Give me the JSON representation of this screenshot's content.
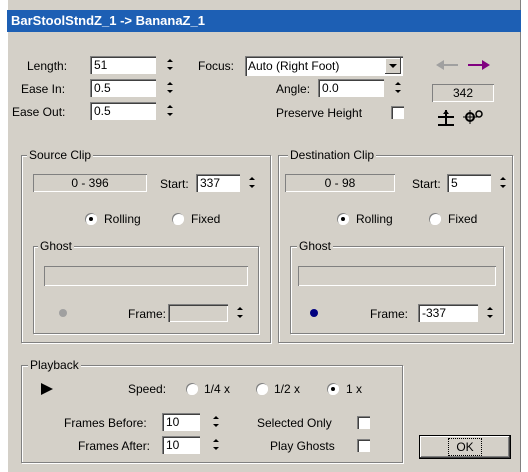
{
  "title": "BarStoolStndZ_1 -> BananaZ_1",
  "transition": {
    "length_label": "Length:",
    "length_value": "51",
    "ease_in_label": "Ease In:",
    "ease_in_value": "0.5",
    "ease_out_label": "Ease Out:",
    "ease_out_value": "0.5",
    "focus_label": "Focus:",
    "focus_value": "Auto (Right Foot)",
    "angle_label": "Angle:",
    "angle_value": "0.0",
    "preserve_height_label": "Preserve Height",
    "frame_readout": "342",
    "icons": [
      "arrow-left-icon",
      "arrow-right-icon",
      "balance-icon",
      "gears-icon"
    ],
    "colors": {
      "arrow_left": "#a0a0a0",
      "arrow_right": "#800080"
    }
  },
  "source_clip": {
    "group_label": "Source Clip",
    "range": "0 - 396",
    "start_label": "Start:",
    "start_value": "337",
    "rolling_label": "Rolling",
    "fixed_label": "Fixed",
    "selected": "Rolling",
    "ghost_label": "Ghost",
    "ghost_name": "",
    "frame_label": "Frame:",
    "frame_value": "",
    "dot_color": "#a0a0a0"
  },
  "dest_clip": {
    "group_label": "Destination Clip",
    "range": "0 - 98",
    "start_label": "Start:",
    "start_value": "5",
    "rolling_label": "Rolling",
    "fixed_label": "Fixed",
    "selected": "Rolling",
    "ghost_label": "Ghost",
    "ghost_name": "",
    "frame_label": "Frame:",
    "frame_value": "-337",
    "dot_color": "#000080"
  },
  "playback": {
    "group_label": "Playback",
    "speed_label": "Speed:",
    "speed_options": [
      "1/4 x",
      "1/2 x",
      "1 x"
    ],
    "speed_selected": "1 x",
    "frames_before_label": "Frames Before:",
    "frames_before_value": "10",
    "frames_after_label": "Frames After:",
    "frames_after_value": "10",
    "selected_only_label": "Selected Only",
    "play_ghosts_label": "Play Ghosts"
  },
  "ok_label": "OK"
}
